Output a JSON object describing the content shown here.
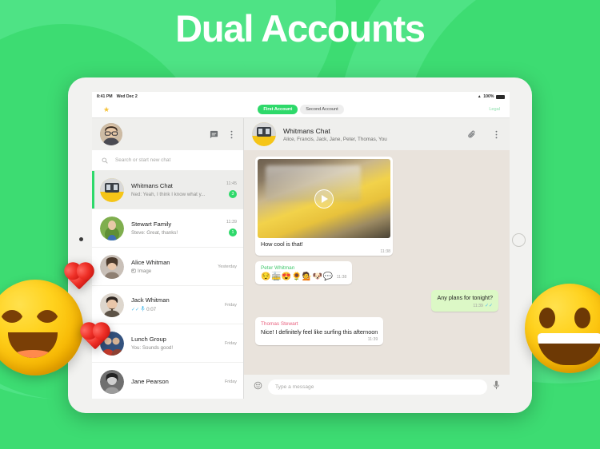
{
  "headline": "Dual Accounts",
  "theme": {
    "brand_green": "#3ddc72",
    "accent_green": "#2ed96a",
    "bubble_out": "#dcf8c6",
    "chat_bg": "#e9e3dc"
  },
  "status_bar": {
    "time": "8:41 PM",
    "date": "Wed Dec 2",
    "wifi_icon": "wifi-icon",
    "battery_percent": "100%",
    "battery_icon": "battery-full-icon"
  },
  "account_bar": {
    "star_icon": "star-icon",
    "tabs": [
      {
        "label": "First Account",
        "active": true
      },
      {
        "label": "Second Account",
        "active": false
      }
    ],
    "legal_label": "Legal"
  },
  "sidebar": {
    "avatar": "user-avatar",
    "new_chat_icon": "new-chat-icon",
    "menu_icon": "overflow-menu-icon",
    "search": {
      "icon": "search-icon",
      "placeholder": "Search or start new chat"
    },
    "chats": [
      {
        "name": "Whitmans Chat",
        "preview": "Ned: Yeah, I think I know what y...",
        "time": "11:45",
        "badge": "3",
        "selected": true,
        "avatar_kind": "tram"
      },
      {
        "name": "Stewart Family",
        "preview": "Steve: Great, thanks!",
        "time": "11:39",
        "badge": "1",
        "selected": false,
        "avatar_kind": "outdoor"
      },
      {
        "name": "Alice Whitman",
        "preview": "Image",
        "time": "Yesterday",
        "badge": "",
        "selected": false,
        "avatar_kind": "woman",
        "preview_icon": "image-icon"
      },
      {
        "name": "Jack Whitman",
        "preview": "0:07",
        "time": "Friday",
        "badge": "",
        "selected": false,
        "avatar_kind": "man-pipe",
        "preview_icon": "voice-note-icon",
        "ticks": "read-ticks-icon"
      },
      {
        "name": "Lunch Group",
        "preview": "You: Sounds good!",
        "time": "Friday",
        "badge": "",
        "selected": false,
        "avatar_kind": "group"
      },
      {
        "name": "Jane Pearson",
        "preview": "",
        "time": "Friday",
        "badge": "",
        "selected": false,
        "avatar_kind": "woman2"
      }
    ]
  },
  "conversation": {
    "avatar": "tram-group-avatar",
    "title": "Whitmans Chat",
    "participants": "Alice, Francis, Jack, Jane, Peter, Thomas, You",
    "attach_icon": "paperclip-icon",
    "menu_icon": "overflow-menu-icon",
    "messages": [
      {
        "type": "media",
        "direction": "in",
        "media_kind": "video-tram",
        "play_icon": "play-icon",
        "caption": "How cool is that!",
        "time": "11:38"
      },
      {
        "type": "emoji",
        "direction": "in",
        "sender": "Peter Whitman",
        "sender_color": "#3fc66a",
        "emojis": "😌🚋😍🌻💁🐶💬",
        "time": "11:38"
      },
      {
        "type": "text",
        "direction": "out",
        "text": "Any plans for tonight?",
        "time": "11:39",
        "ticks": "read-ticks-icon"
      },
      {
        "type": "text",
        "direction": "in",
        "sender": "Thomas Stewart",
        "sender_color": "#e8607e",
        "text": "Nice! I definitely feel like surfing this afternoon",
        "time": "11:39"
      }
    ],
    "composer": {
      "emoji_icon": "emoji-icon",
      "placeholder": "Type a message",
      "mic_icon": "microphone-icon"
    }
  },
  "decorations": {
    "emoji_left": "smiling-face-emoji",
    "emoji_right": "grinning-face-emoji",
    "hearts": [
      "heart-emoji",
      "heart-emoji"
    ]
  }
}
